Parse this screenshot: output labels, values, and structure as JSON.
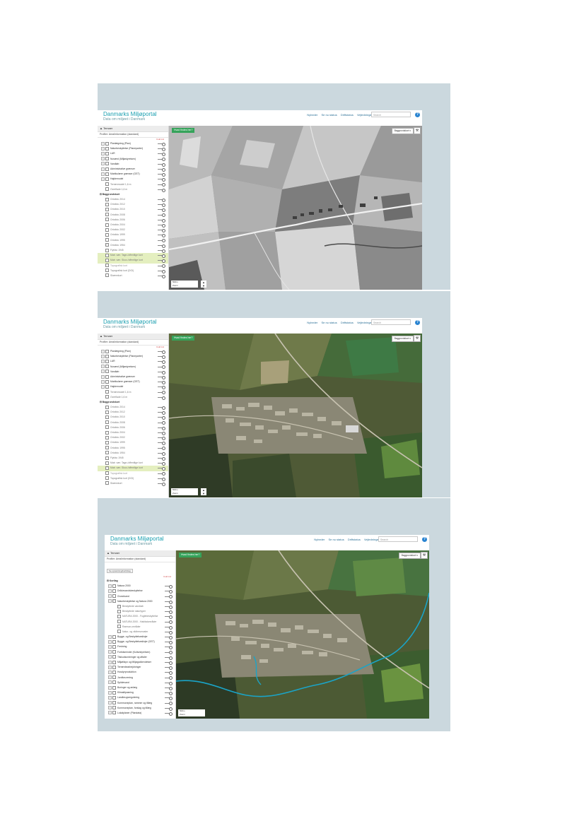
{
  "header": {
    "logo_title": "Danmarks Miljøportal",
    "logo_tagline": "Data om miljøet i Danmark",
    "nav": [
      "Nyheder",
      "Se nu status",
      "Driftstatus",
      "Vejledninger"
    ],
    "search_placeholder": "Search"
  },
  "toolbar": {
    "what_is_here": "Hvad findes her?",
    "background_map": "Baggrundskort ▾"
  },
  "sidebar": {
    "title": "Temaer",
    "profile": "Profiler: Arealinformation (standard)",
    "fold_label": "Fold ind",
    "sub_button": "Se opsætning/kortbilag"
  },
  "panel1_layers": [
    {
      "kind": "layer",
      "text": "Planlægning (Plan)",
      "checked": false
    },
    {
      "kind": "layer",
      "text": "Naturbeskyttelse (Planeparter)",
      "checked": false
    },
    {
      "kind": "layer",
      "text": "LAR",
      "checked": false
    },
    {
      "kind": "layer",
      "text": "Nuværd (Miljøstyrelsen)",
      "checked": false
    },
    {
      "kind": "layer",
      "text": "Vandløb",
      "checked": false
    },
    {
      "kind": "layer",
      "text": "Administrative grænser",
      "checked": false
    },
    {
      "kind": "layer",
      "text": "Matrikulære grænser (GST)",
      "checked": false
    },
    {
      "kind": "layer",
      "text": "Højdemodel",
      "checked": false
    },
    {
      "kind": "sub",
      "text": "Terrænmodel 1,6 m",
      "checked": false
    },
    {
      "kind": "sub",
      "text": "Overflade 1,6 m",
      "checked": false
    },
    {
      "kind": "section",
      "text": "Baggrundskort"
    },
    {
      "kind": "sub",
      "text": "Ortofoto 2014",
      "checked": false
    },
    {
      "kind": "sub",
      "text": "Ortofoto 2012",
      "checked": false
    },
    {
      "kind": "sub",
      "text": "Ortofoto 2010",
      "checked": false
    },
    {
      "kind": "sub",
      "text": "Ortofoto 2008",
      "checked": false
    },
    {
      "kind": "sub",
      "text": "Ortofoto 2006",
      "checked": false
    },
    {
      "kind": "sub",
      "text": "Ortofoto 2004",
      "checked": false
    },
    {
      "kind": "sub",
      "text": "Ortofoto 2002",
      "checked": false
    },
    {
      "kind": "sub",
      "text": "Ortofoto 1999",
      "checked": false
    },
    {
      "kind": "sub",
      "text": "Ortofoto 1995",
      "checked": false
    },
    {
      "kind": "sub",
      "text": "Ortofoto 1954",
      "checked": true
    },
    {
      "kind": "sub",
      "text": "Flyfoto 1945",
      "checked": false
    },
    {
      "kind": "sub",
      "text": "Matr. vær. Tage-/offentlige kort",
      "checked": false,
      "hl": true
    },
    {
      "kind": "sub",
      "text": "Matr. vær. Skov-/offentlige kort",
      "checked": false,
      "hl": true
    },
    {
      "kind": "sub",
      "text": "Topografisk kort",
      "checked": false,
      "dim": true
    },
    {
      "kind": "sub",
      "text": "Topografisk kort (DGI)",
      "checked": false
    },
    {
      "kind": "sub",
      "text": "Skærmkort",
      "checked": false
    }
  ],
  "panel2_layers": [
    {
      "kind": "layer",
      "text": "Planlægning (Plan)",
      "checked": false
    },
    {
      "kind": "layer",
      "text": "Naturbeskyttelse (Planeparter)",
      "checked": false
    },
    {
      "kind": "layer",
      "text": "LAR",
      "checked": false
    },
    {
      "kind": "layer",
      "text": "Nuværd (Miljøstyrelsen)",
      "checked": false
    },
    {
      "kind": "layer",
      "text": "Vandløb",
      "checked": false
    },
    {
      "kind": "layer",
      "text": "Administrative grænser",
      "checked": false
    },
    {
      "kind": "layer",
      "text": "Matrikulære grænser (GST)",
      "checked": false
    },
    {
      "kind": "layer",
      "text": "Højdemodel",
      "checked": false
    },
    {
      "kind": "sub",
      "text": "Terrænmodel 1,6 m",
      "checked": false
    },
    {
      "kind": "sub",
      "text": "Overflade 1,6 m",
      "checked": false
    },
    {
      "kind": "section",
      "text": "Baggrundskort"
    },
    {
      "kind": "sub",
      "text": "Ortofoto 2014",
      "checked": false
    },
    {
      "kind": "sub",
      "text": "Ortofoto 2012",
      "checked": false
    },
    {
      "kind": "sub",
      "text": "Ortofoto 2010",
      "checked": false
    },
    {
      "kind": "sub",
      "text": "Ortofoto 2008",
      "checked": false
    },
    {
      "kind": "sub",
      "text": "Ortofoto 2006",
      "checked": false
    },
    {
      "kind": "sub",
      "text": "Ortofoto 2004",
      "checked": false
    },
    {
      "kind": "sub",
      "text": "Ortofoto 2002",
      "checked": false
    },
    {
      "kind": "sub",
      "text": "Ortofoto 1999",
      "checked": false
    },
    {
      "kind": "sub",
      "text": "Ortofoto 1995",
      "checked": false
    },
    {
      "kind": "sub",
      "text": "Ortofoto 1954",
      "checked": false
    },
    {
      "kind": "sub",
      "text": "Flyfoto 1945",
      "checked": false
    },
    {
      "kind": "sub",
      "text": "Matr. vær. Tage-/offentlige kort",
      "checked": false
    },
    {
      "kind": "sub",
      "text": "Matr. vær. Skov-/offentlige kort",
      "checked": true,
      "hl": true
    },
    {
      "kind": "sub",
      "text": "Topografisk kort",
      "checked": false,
      "dim": true
    },
    {
      "kind": "sub",
      "text": "Topografisk kort (DGI)",
      "checked": false
    },
    {
      "kind": "sub",
      "text": "Skærmkort",
      "checked": false
    }
  ],
  "panel3_layers": [
    {
      "kind": "section",
      "text": "Kortlag"
    },
    {
      "kind": "layer",
      "text": "Natura 2000",
      "checked": false
    },
    {
      "kind": "layer",
      "text": "Drikkevandsbeskyttelse",
      "checked": false
    },
    {
      "kind": "layer",
      "text": "Grundvand",
      "checked": false
    },
    {
      "kind": "layer",
      "text": "Naturbeskyttelse og Natura 2000",
      "checked": true
    },
    {
      "kind": "sub3",
      "text": "Beskyttede vandløb",
      "checked": true
    },
    {
      "kind": "sub3",
      "text": "Beskyttede naturtyper",
      "checked": false
    },
    {
      "kind": "sub3",
      "text": "NATURA 2000 - Fuglebeskyttelse",
      "checked": false
    },
    {
      "kind": "sub3",
      "text": "NATURA 2000 - Habitatområder",
      "checked": false
    },
    {
      "kind": "sub3",
      "text": "Ramsar-områder",
      "checked": false
    },
    {
      "kind": "sub3",
      "text": "Natur- og vildtreservater",
      "checked": false
    },
    {
      "kind": "layer",
      "text": "Bygge- og Beskyttelseslinjer",
      "checked": false
    },
    {
      "kind": "layer",
      "text": "Bygge- og Beskyttelseslinjer (GST)",
      "checked": false
    },
    {
      "kind": "layer",
      "text": "Fredning",
      "checked": false
    },
    {
      "kind": "layer",
      "text": "Fortidsminder (Kulturstyrelsen)",
      "checked": false
    },
    {
      "kind": "layer",
      "text": "Tilskudsordninger og aftaler",
      "checked": false
    },
    {
      "kind": "layer",
      "text": "Miljøtilsyn og Miljøgodkendelser",
      "checked": false
    },
    {
      "kind": "layer",
      "text": "Terrænbearbejdninger",
      "checked": false
    },
    {
      "kind": "layer",
      "text": "Husdyrproduktion",
      "checked": false
    },
    {
      "kind": "layer",
      "text": "Jordforurening",
      "checked": false
    },
    {
      "kind": "layer",
      "text": "Spildevand",
      "checked": false
    },
    {
      "kind": "layer",
      "text": "Boringer og anlæg",
      "checked": false
    },
    {
      "kind": "layer",
      "text": "Klimatilpasning",
      "checked": false
    },
    {
      "kind": "layer",
      "text": "Landbrugsregulering",
      "checked": false
    },
    {
      "kind": "layer",
      "text": "Kommuneplan, rammer og tillæg",
      "checked": false
    },
    {
      "kind": "layer",
      "text": "Kommuneplan, forslag og tillæg",
      "checked": false
    },
    {
      "kind": "layer",
      "text": "Lokalplaner (Plandata)",
      "checked": false
    }
  ],
  "scale_labels": [
    "500m",
    "Zoom"
  ],
  "colors": {
    "brand": "#1a9fb0",
    "panel_bg": "#cbd8de",
    "highlight": "#e4efbf",
    "stream": "#1aa4c8",
    "button_green": "#35a35a"
  }
}
